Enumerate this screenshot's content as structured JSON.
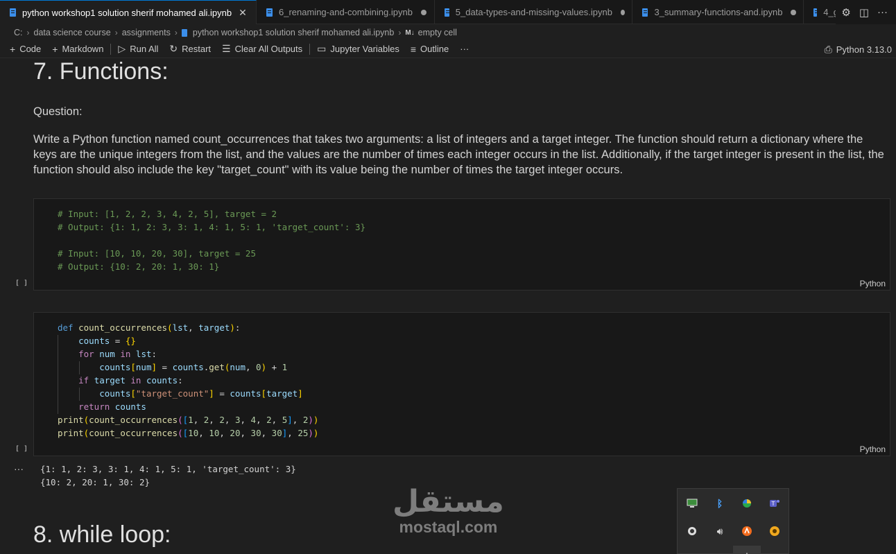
{
  "tabs": [
    {
      "label": "python workshop1 solution sherif mohamed ali.ipynb",
      "active": true,
      "close": "✕"
    },
    {
      "label": "6_renaming-and-combining.ipynb",
      "active": false
    },
    {
      "label": "5_data-types-and-missing-values.ipynb",
      "active": false
    },
    {
      "label": "3_summary-functions-and.ipynb",
      "active": false
    },
    {
      "label": "4_g",
      "active": false
    }
  ],
  "breadcrumb": {
    "items": [
      "C:",
      "data science course",
      "assignments",
      "python workshop1 solution sherif mohamed ali.ipynb",
      "empty cell"
    ],
    "md_badge": "M↓"
  },
  "toolbar": {
    "code": "Code",
    "markdown": "Markdown",
    "run_all": "Run All",
    "restart": "Restart",
    "clear_outputs": "Clear All Outputs",
    "variables": "Jupyter Variables",
    "outline": "Outline",
    "more": "···",
    "kernel": "Python 3.13.0"
  },
  "notebook": {
    "heading7": "7. Functions:",
    "question_label": "Question:",
    "question_body": "Write a Python function named count_occurrences that takes two arguments: a list of integers and a target integer. The function should return a dictionary where the keys are the unique integers from the list, and the values are the number of times each integer occurs in the list. Additionally, if the target integer is present in the list, the function should also include the key \"target_count\" with its value being the number of times the target integer occurs.",
    "cell1": {
      "exec": "[ ]",
      "lang": "Python",
      "lines": [
        "# Input: [1, 2, 2, 3, 4, 2, 5], target = 2",
        "# Output: {1: 1, 2: 3, 3: 1, 4: 1, 5: 1, 'target_count': 3}",
        "",
        "# Input: [10, 10, 20, 30], target = 25",
        "# Output: {10: 2, 20: 1, 30: 1}"
      ]
    },
    "cell2": {
      "exec": "[ ]",
      "lang": "Python",
      "code": [
        "def count_occurrences(lst, target):",
        "    counts = {}",
        "    for num in lst:",
        "        counts[num] = counts.get(num, 0) + 1",
        "    if target in counts:",
        "        counts[\"target_count\"] = counts[target]",
        "    return counts",
        "print(count_occurrences([1, 2, 2, 3, 4, 2, 5], 2))",
        "print(count_occurrences([10, 10, 20, 30, 30], 25))"
      ]
    },
    "output_marker": "···",
    "output": [
      "{1: 1, 2: 3, 3: 1, 4: 1, 5: 1, 'target_count': 3}",
      "{10: 2, 20: 1, 30: 2}"
    ],
    "heading8": "8. while loop:"
  },
  "watermark": {
    "arabic": "مستقل",
    "latin": "mostaql.com"
  },
  "colors": {
    "accent": "#0078d4",
    "editor_bg": "#1f1f1f",
    "cell_bg": "#181818"
  }
}
